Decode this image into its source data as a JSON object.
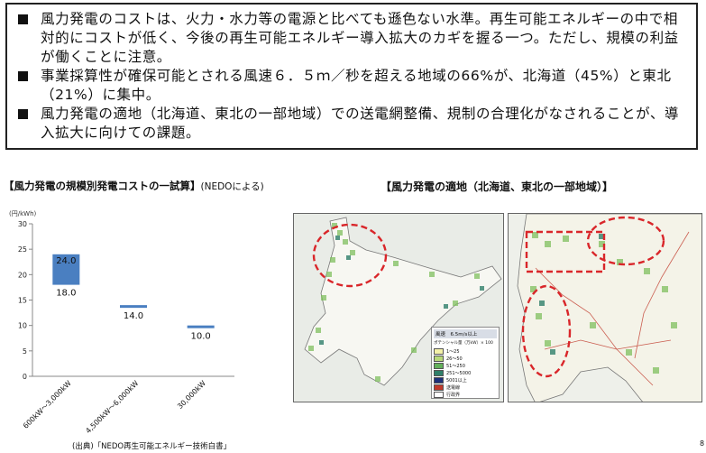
{
  "summary": {
    "bullets": [
      "風力発電のコストは、火力・水力等の電源と比べても遜色ない水準。再生可能エネルギーの中で相対的にコストが低く、今後の再生可能エネルギー導入拡大のカギを握る一つ。ただし、規模の利益が働くことに注意。",
      "事業採算性が確保可能とされる風速６．５ｍ／秒を超える地域の66%が、北海道（45%）と東北（21%）に集中。",
      "風力発電の適地（北海道、東北の一部地域）での送電網整備、規制の合理化がなされることが、導入拡大に向けての課題。"
    ]
  },
  "left_chart": {
    "title": "【風力発電の規模別発電コストの一試算】",
    "title_note": "(NEDOによる)",
    "source": "(出典)「NEDO再生可能エネルギー技術白書」"
  },
  "chart_data": {
    "type": "bar",
    "title": "【風力発電の規模別発電コストの一試算】",
    "ylabel": "(円/kWh)",
    "ylim": [
      0,
      30
    ],
    "yticks": [
      0,
      5,
      10,
      15,
      20,
      25,
      30
    ],
    "categories": [
      "600kW～3,000kW",
      "4,500kW～6,000kW",
      "30,000kW"
    ],
    "ranges": [
      {
        "category": "600kW～3,000kW",
        "low": 18.0,
        "high": 24.0
      },
      {
        "category": "4,500kW～6,000kW",
        "low": 14.0,
        "high": 14.0
      },
      {
        "category": "30,000kW",
        "low": 10.0,
        "high": 10.0
      }
    ],
    "data_labels": [
      {
        "category": "600kW～3,000kW",
        "high": "24.0",
        "low": "18.0"
      },
      {
        "category": "4,500kW～6,000kW",
        "value": "14.0"
      },
      {
        "category": "30,000kW",
        "value": "10.0"
      }
    ],
    "bar_color": "#4a7fc1",
    "grid": false
  },
  "maps": {
    "title": "【風力発電の適地（北海道、東北の一部地域）】",
    "legend": {
      "title": "風速　6.5m/s以上",
      "subtitle": "ポテンシャル量（万kW）× 100",
      "items": [
        {
          "label": "1～25",
          "color": "#f4f1a8"
        },
        {
          "label": "26～50",
          "color": "#b8d97a"
        },
        {
          "label": "51～250",
          "color": "#64b05c"
        },
        {
          "label": "251～5000",
          "color": "#2f7f6a"
        },
        {
          "label": "5001以上",
          "color": "#1d2f7a"
        },
        {
          "label": "送電線",
          "color": "#c0392b"
        },
        {
          "label": "行政界",
          "color": "#ffffff"
        }
      ]
    },
    "highlight_color": "#d9262a"
  },
  "page_number": "8"
}
